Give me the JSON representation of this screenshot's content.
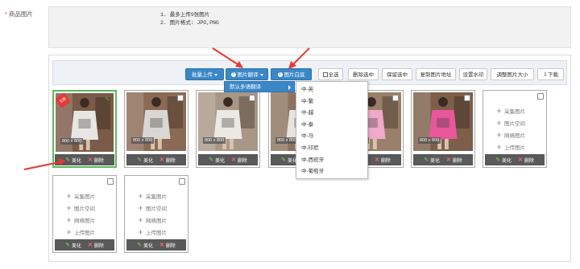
{
  "field": {
    "required_mark": "*",
    "label": "商品图片"
  },
  "tips": {
    "line1": "1. 最多上传9张图片",
    "line2": "2. 图片格式: JPG,PNG"
  },
  "toolbar": {
    "batch_upload": "批量上传",
    "image_translate": "图片翻译",
    "image_white_bg": "图片白底",
    "select_all": "全选",
    "delete_selected": "删除选中",
    "keep_selected": "保留选中",
    "copy_image_url": "复制图片地址",
    "set_watermark": "设置水印",
    "resize_image": "调整图片大小",
    "download": "下载"
  },
  "dropdown": {
    "level1": "默认多语翻译",
    "options": [
      "中-英",
      "中-繁",
      "中-越",
      "中-泰",
      "中-马",
      "中-印尼",
      "中-西班牙",
      "中-葡萄牙"
    ]
  },
  "images": [
    {
      "size": "800 x 800",
      "badge": "主图",
      "selected": true,
      "tint": "#7a5a48",
      "shirt": "#e8e6e2"
    },
    {
      "size": "800 x 800",
      "badge": "",
      "selected": false,
      "tint": "#8a6a55",
      "shirt": "#d9d7d3"
    },
    {
      "size": "800 x 800",
      "badge": "",
      "selected": false,
      "tint": "#a89786",
      "shirt": "#ebe9e4"
    },
    {
      "size": "800 x 800",
      "badge": "",
      "selected": false,
      "tint": "#8d7460",
      "shirt": "#e6e4df"
    },
    {
      "size": "800 x 800",
      "badge": "",
      "selected": false,
      "tint": "#9a7f6a",
      "shirt": "#f0a9c9"
    },
    {
      "size": "800 x 800",
      "badge": "",
      "selected": false,
      "tint": "#7c5e4a",
      "shirt": "#e8579a"
    }
  ],
  "tile_actions": {
    "beautify": "美化",
    "delete": "删除"
  },
  "upload_options": [
    "采集图片",
    "图片空间",
    "网络图片",
    "上传图片"
  ],
  "colors": {
    "primary": "#3a87c8",
    "selected_border": "#5cb85c",
    "required": "#e53935",
    "annotation_arrow": "#e53935"
  }
}
